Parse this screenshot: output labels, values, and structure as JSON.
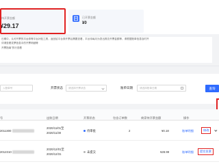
{
  "stats": {
    "pending": {
      "label": "待开票金额",
      "value": "¥29.17"
    },
    "issued": {
      "label": "已开票金额",
      "value": "¥0"
    }
  },
  "notes": [
    "日期中，认可开票的平台券等平台补贴工具，返回给平台券开票后需要查看，平台待每月为您出具总开票金额等，请根据账单信息及时开",
    "详请查看发票信息中的开票明细等",
    "开票指南\"的行查看"
  ],
  "filters": {
    "bill_no": {
      "placeholder": "入账单号"
    },
    "status": {
      "label": "开票状态",
      "placeholder": "请选择开票状态"
    },
    "date": {
      "label": "账单日期",
      "placeholder": "请选择账单日期"
    },
    "query_label": "查询"
  },
  "table": {
    "headers": [
      "号",
      "出账日期",
      "开票状态",
      "包含订单数",
      "商家待开票金额",
      "操作"
    ],
    "rows": [
      {
        "bill_no": "2011300",
        "date_from": "2020/11/01至",
        "date_to": "2020/11/30",
        "status": "待审批",
        "order_count": "2",
        "amount": "¥0.18",
        "action1": "账单明细",
        "action2": "修改"
      },
      {
        "bill_no": "2012310",
        "date_from": "2020/12/01至",
        "date_to": "2020/12/31",
        "status": "未提交",
        "order_count": "",
        "amount": "¥28.99",
        "action1": "账单明细",
        "action2": "提交发票"
      }
    ]
  },
  "colors": {
    "accent": "#2f6bff",
    "highlight": "#e02020"
  }
}
